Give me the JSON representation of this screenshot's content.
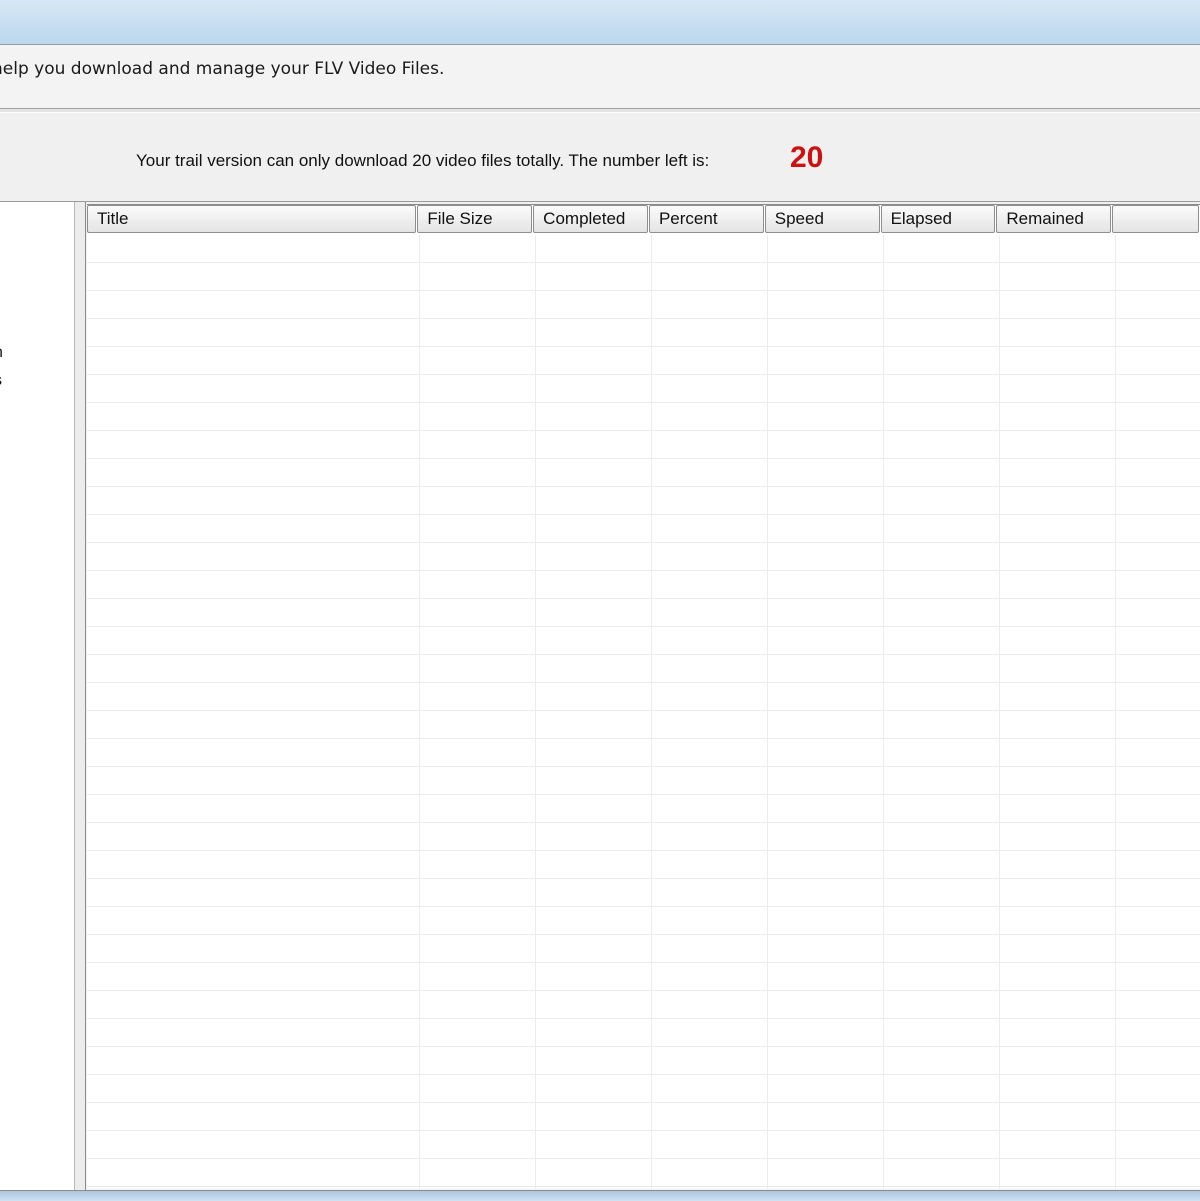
{
  "header": {
    "description": "help you download and manage your FLV Video Files."
  },
  "trial": {
    "message": "Your trail version can only download 20 video files totally. The number left is:",
    "count": "20",
    "count_color": "#cc1111"
  },
  "sidebar": {
    "items": [
      {
        "label": "n"
      },
      {
        "label": "s"
      }
    ]
  },
  "downloads_table": {
    "columns": [
      {
        "label": "Title"
      },
      {
        "label": "File Size"
      },
      {
        "label": "Completed"
      },
      {
        "label": "Percent"
      },
      {
        "label": "Speed"
      },
      {
        "label": "Elapsed"
      },
      {
        "label": "Remained"
      },
      {
        "label": ""
      }
    ],
    "rows": []
  }
}
